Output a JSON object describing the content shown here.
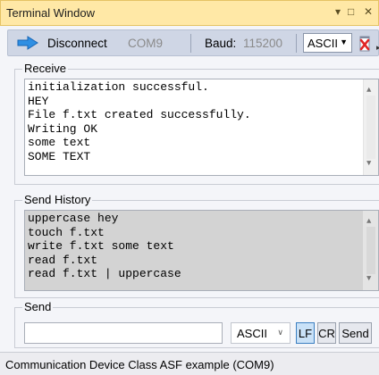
{
  "window": {
    "title": "Terminal Window",
    "dropdown_glyph": "▾",
    "maximize_glyph": "□",
    "close_glyph": "✕"
  },
  "toolbar": {
    "connect_icon": "arrow-right-icon",
    "disconnect_label": "Disconnect",
    "port": "COM9",
    "baud_label": "Baud:",
    "baud_value": "115200",
    "mode_value": "ASCII",
    "clear_icon": "clear-document-icon"
  },
  "receive": {
    "legend": "Receive",
    "lines": [
      "initialization successful.",
      "HEY",
      "File f.txt created successfully.",
      "Writing OK",
      "some text",
      "SOME TEXT"
    ]
  },
  "history": {
    "legend": "Send History",
    "lines": [
      "uppercase hey",
      "touch f.txt",
      "write f.txt some text",
      "read f.txt",
      "read f.txt | uppercase"
    ]
  },
  "send": {
    "legend": "Send",
    "input_value": "",
    "mode_value": "ASCII",
    "lf_label": "LF",
    "cr_label": "CR",
    "send_label": "Send"
  },
  "status": {
    "text": "Communication Device Class ASF example (COM9)"
  },
  "colors": {
    "titlebar": "#ffe8a6",
    "toolbar": "#cfd6e5",
    "history_bg": "#d3d3d3",
    "accent": "#3c7fc1"
  }
}
